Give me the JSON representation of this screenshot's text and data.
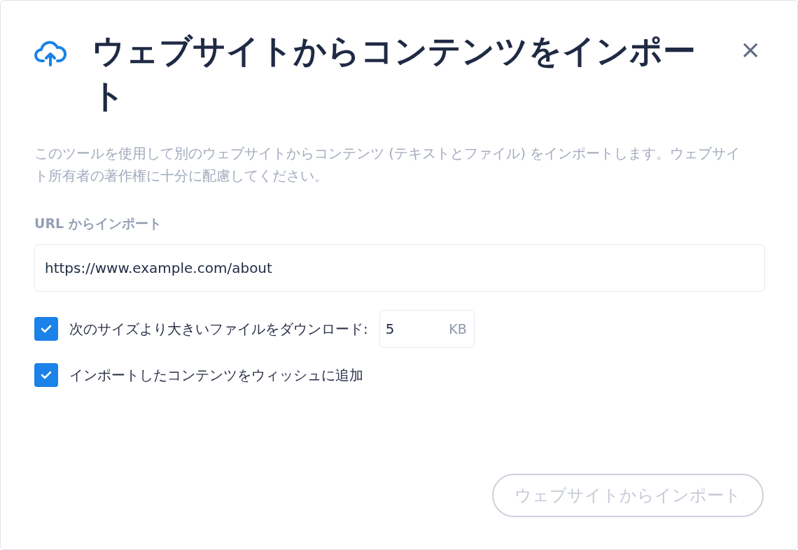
{
  "dialog": {
    "title": "ウェブサイトからコンテンツをインポート",
    "close": "×",
    "description": "このツールを使用して別のウェブサイトからコンテンツ (テキストとファイル) をインポートします。ウェブサイト所有者の著作権に十分に配慮してください。",
    "url_field": {
      "label": "URL からインポート",
      "value": "https://www.example.com/about"
    },
    "options": [
      {
        "label": "次のサイズより大きいファイルをダウンロード:",
        "checked": true,
        "size": {
          "value": "5",
          "unit": "KB"
        }
      },
      {
        "label": "インポートしたコンテンツをウィッシュに追加",
        "checked": true
      }
    ],
    "submit": {
      "label": "ウェブサイトからインポート",
      "disabled": true
    }
  }
}
